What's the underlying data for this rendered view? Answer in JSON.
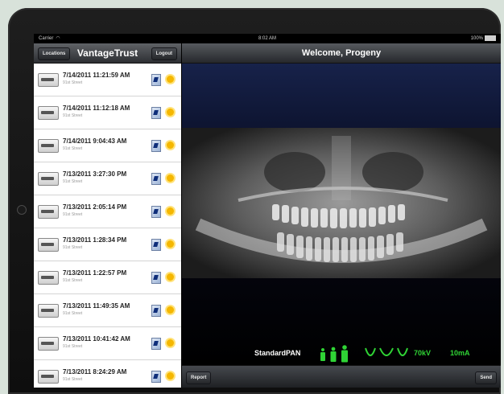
{
  "status_bar": {
    "carrier": "Carrier",
    "time": "8:02 AM",
    "battery": "100%"
  },
  "left_nav": {
    "locations_label": "Locations",
    "title": "VantageTrust",
    "logout_label": "Logout"
  },
  "right_nav": {
    "title": "Welcome, Progeny"
  },
  "exam_list": [
    {
      "date": "7/14/2011 11:21:59 AM",
      "location": "91st Street"
    },
    {
      "date": "7/14/2011 11:12:18 AM",
      "location": "91st Street"
    },
    {
      "date": "7/14/2011 9:04:43 AM",
      "location": "91st Street"
    },
    {
      "date": "7/13/2011 3:27:30 PM",
      "location": "91st Street"
    },
    {
      "date": "7/13/2011 2:05:14 PM",
      "location": "91st Street"
    },
    {
      "date": "7/13/2011 1:28:34 PM",
      "location": "91st Street"
    },
    {
      "date": "7/13/2011 1:22:57 PM",
      "location": "91st Street"
    },
    {
      "date": "7/13/2011 11:49:35 AM",
      "location": "91st Street"
    },
    {
      "date": "7/13/2011 10:41:42 AM",
      "location": "91st Street"
    },
    {
      "date": "7/13/2011 8:24:29 AM",
      "location": "91st Street"
    }
  ],
  "exam_info": {
    "mode_prefix": "Standard",
    "mode_suffix": "PAN",
    "kv": "70kV",
    "ma": "10mA"
  },
  "bottom_bar": {
    "report_label": "Report",
    "send_label": "Send"
  },
  "colors": {
    "accent_green": "#2fd435",
    "list_bg": "#ffffff"
  }
}
